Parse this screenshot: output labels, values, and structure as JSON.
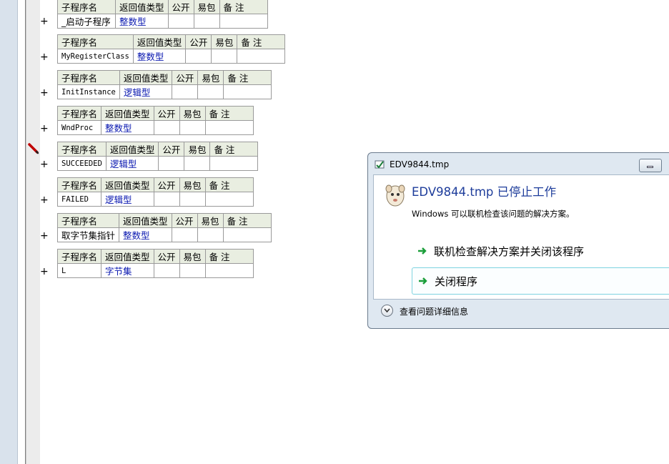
{
  "headers": {
    "name": "子程序名",
    "return_type": "返回值类型",
    "public": "公开",
    "easy_pkg": "易包",
    "remark": "备 注"
  },
  "plus_symbol": "+",
  "subroutines": [
    {
      "name": "_启动子程序",
      "type": "整数型"
    },
    {
      "name": "MyRegisterClass",
      "type": "整数型"
    },
    {
      "name": "InitInstance",
      "type": "逻辑型"
    },
    {
      "name": "WndProc",
      "type": "整数型"
    },
    {
      "name": "SUCCEEDED",
      "type": "逻辑型"
    },
    {
      "name": "FAILED",
      "type": "逻辑型"
    },
    {
      "name": "取字节集指针",
      "type": "整数型"
    },
    {
      "name": "L",
      "type": "字节集"
    }
  ],
  "dialog": {
    "title": "EDV9844.tmp",
    "heading": "EDV9844.tmp 已停止工作",
    "message": "Windows 可以联机检查该问题的解决方案。",
    "option_check_online": "联机检查解决方案并关闭该程序",
    "option_close": "关闭程序",
    "details": "查看问题详细信息"
  },
  "colors": {
    "header_bg": "#e9eee1",
    "type_text": "#0a18b0",
    "dialog_heading": "#1e3d9b",
    "arrow_green": "#1b9e3a"
  },
  "icons": {
    "edit_marker": "pencil-icon",
    "dialog_app": "app-icon",
    "dialog_mascot": "mascot-icon",
    "option_arrow": "green-arrow-icon",
    "expand": "chevron-down-icon"
  }
}
